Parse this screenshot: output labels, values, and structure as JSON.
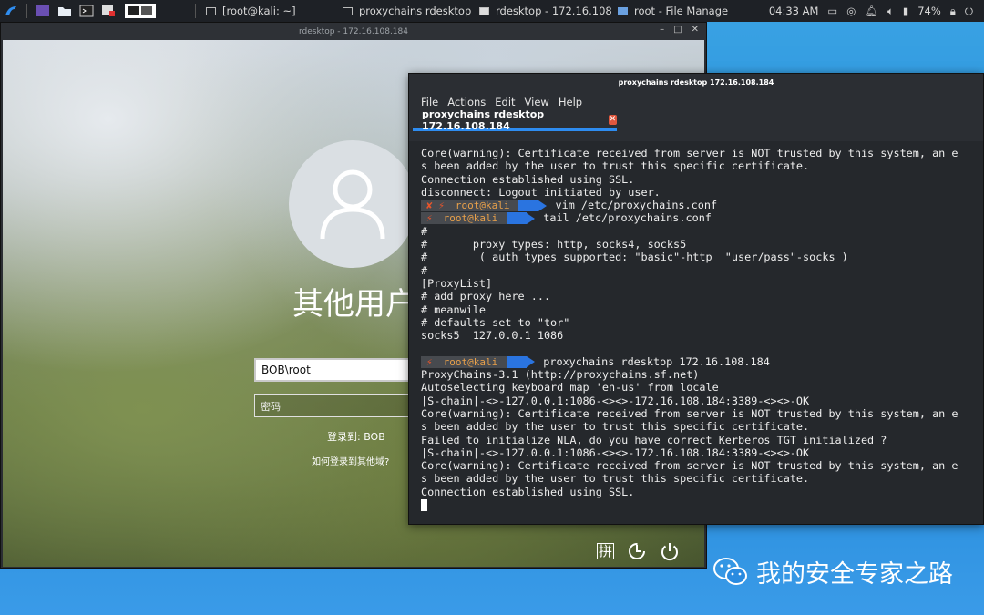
{
  "taskbar": {
    "tasks": [
      {
        "label": "[root@kali: ~]"
      },
      {
        "label": "proxychains rdesktop 17..."
      },
      {
        "label": "rdesktop - 172.16.108.184"
      },
      {
        "label": "root - File Manager"
      }
    ],
    "clock": "04:33 AM",
    "battery": "74%"
  },
  "rdesktop": {
    "title": "rdesktop - 172.16.108.184",
    "login": {
      "username_heading": "其他用户",
      "user_value": "BOB\\root",
      "password_placeholder": "密码",
      "login_to": "登录到: BOB",
      "other_domain_link": "如何登录到其他域?",
      "ime_label": "拼"
    }
  },
  "terminal": {
    "title": "proxychains rdesktop 172.16.108.184",
    "menu": [
      "File",
      "Actions",
      "Edit",
      "View",
      "Help"
    ],
    "tab_label": "proxychains rdesktop 172.16.108.184",
    "prompt_user": "root@kali",
    "lines": [
      {
        "text": "Core(warning): Certificate received from server is NOT trusted by this system, an e"
      },
      {
        "text": "s been added by the user to trust this specific certificate."
      },
      {
        "text": "Connection established using SSL."
      },
      {
        "text": "disconnect: Logout initiated by user."
      },
      {
        "prompt": true,
        "status": "✘ ⚡",
        "text": "vim /etc/proxychains.conf"
      },
      {
        "prompt": true,
        "status": "⚡",
        "text": "tail /etc/proxychains.conf"
      },
      {
        "text": "#"
      },
      {
        "text": "#       proxy types: http, socks4, socks5"
      },
      {
        "text": "#        ( auth types supported: \"basic\"-http  \"user/pass\"-socks )"
      },
      {
        "text": "#"
      },
      {
        "text": "[ProxyList]"
      },
      {
        "text": "# add proxy here ..."
      },
      {
        "text": "# meanwile"
      },
      {
        "text": "# defaults set to \"tor\""
      },
      {
        "text": "socks5  127.0.0.1 1086"
      },
      {
        "text": ""
      },
      {
        "prompt": true,
        "status": "⚡",
        "text": "proxychains rdesktop 172.16.108.184"
      },
      {
        "text": "ProxyChains-3.1 (http://proxychains.sf.net)"
      },
      {
        "text": "Autoselecting keyboard map 'en-us' from locale"
      },
      {
        "text": "|S-chain|-<>-127.0.0.1:1086-<><>-172.16.108.184:3389-<><>-OK"
      },
      {
        "text": "Core(warning): Certificate received from server is NOT trusted by this system, an e"
      },
      {
        "text": "s been added by the user to trust this specific certificate."
      },
      {
        "text": "Failed to initialize NLA, do you have correct Kerberos TGT initialized ?"
      },
      {
        "text": "|S-chain|-<>-127.0.0.1:1086-<><>-172.16.108.184:3389-<><>-OK"
      },
      {
        "text": "Core(warning): Certificate received from server is NOT trusted by this system, an e"
      },
      {
        "text": "s been added by the user to trust this specific certificate."
      },
      {
        "text": "Connection established using SSL."
      },
      {
        "cursor": true,
        "text": ""
      }
    ]
  },
  "watermark": {
    "text": "我的安全专家之路"
  },
  "colors": {
    "accent": "#2e8cf0",
    "prompt_arrow": "#2a74e0",
    "error_x": "#e8552b",
    "prompt_user": "#e8a04a"
  }
}
